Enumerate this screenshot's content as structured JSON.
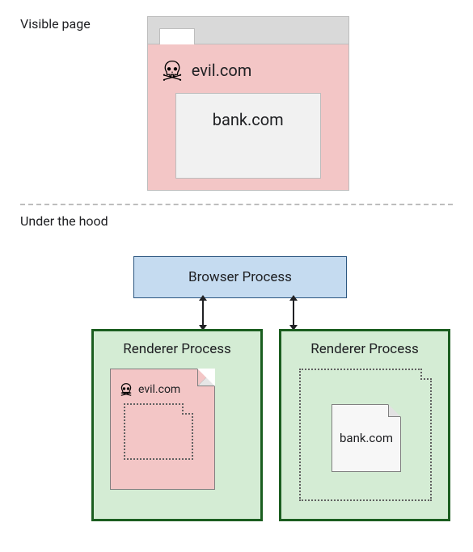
{
  "top": {
    "section_label": "Visible page",
    "evil_label": "evil.com",
    "iframe_label": "bank.com",
    "skull_icon": "skull-crossbones"
  },
  "bottom": {
    "section_label": "Under the hood",
    "browser_process": "Browser Process",
    "renderers": [
      {
        "title": "Renderer Process",
        "page_label": "evil.com"
      },
      {
        "title": "Renderer Process",
        "page_label": "bank.com"
      }
    ]
  }
}
